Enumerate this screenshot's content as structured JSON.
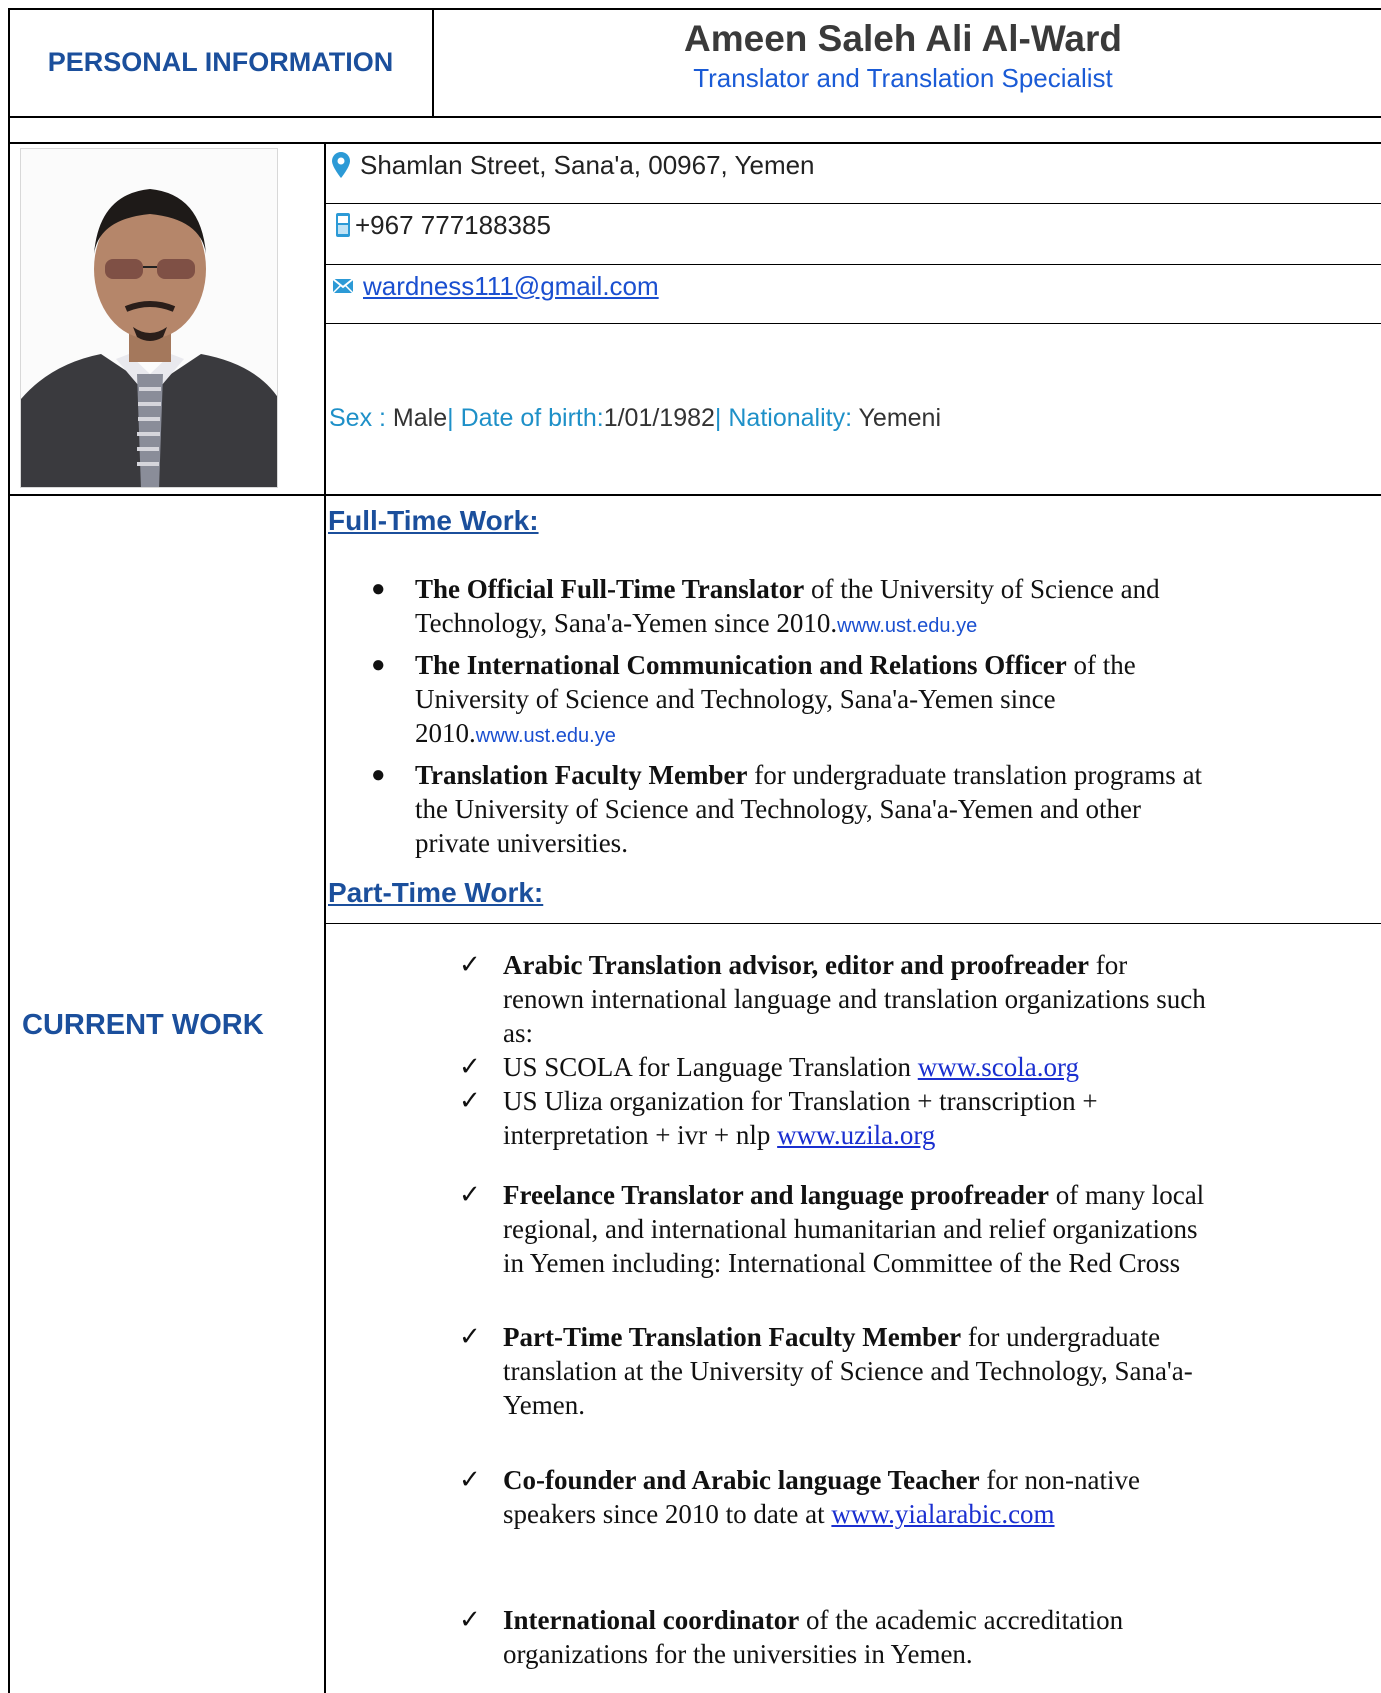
{
  "header": {
    "section_label": "PERSONAL INFORMATION",
    "name": "Ameen Saleh Ali Al-Ward",
    "title": "Translator and Translation Specialist"
  },
  "photo": {
    "description": "portrait-photo"
  },
  "contact": {
    "address": "Shamlan Street, Sana'a, 00967, Yemen",
    "phone": "+967 777188385",
    "email": "wardness111@gmail.com"
  },
  "personal": {
    "sex_label": "Sex : ",
    "sex_value": "Male",
    "sep1": "| ",
    "dob_label": "Date of birth:",
    "dob_value": "1/01/1982",
    "sep2": "| ",
    "nationality_label": "Nationality: ",
    "nationality_value": "Yemeni"
  },
  "current_work": {
    "section_label": "CURRENT WORK",
    "full_time_heading": "Full-Time Work:",
    "full_time_items": [
      {
        "bold": "The Official Full-Time Translator",
        "l1": " of the University of Science and",
        "l2": "Technology, Sana'a-Yemen since 2010.",
        "url": "www.ust.edu.ye"
      },
      {
        "bold": "The International Communication and Relations Officer",
        "l1": " of the",
        "l2": "University of Science and Technology, Sana'a-Yemen since",
        "l3": "2010.",
        "url": "www.ust.edu.ye"
      },
      {
        "bold": "Translation Faculty Member",
        "l1": " for undergraduate translation programs at",
        "l2": "the University of Science and Technology, Sana'a-Yemen and other",
        "l3": "private universities."
      }
    ],
    "part_time_heading": "Part-Time Work:",
    "part_time_items": [
      {
        "bold": "Arabic Translation advisor, editor and proofreader",
        "l1": " for",
        "l2": "renown international language and translation organizations such",
        "l3": "as:"
      },
      {
        "text": "US SCOLA for Language Translation ",
        "link": "www.scola.org"
      },
      {
        "l1": "US Uliza organization for Translation + transcription +",
        "l2": "interpretation + ivr + nlp ",
        "link": "www.uzila.org"
      },
      {
        "bold": "Freelance Translator and language proofreader",
        "l1": " of many local",
        "l2": "regional, and international humanitarian and relief organizations",
        "l3": "in Yemen including: International Committee of the Red Cross"
      },
      {
        "bold": "Part-Time Translation Faculty Member",
        "l1": " for undergraduate",
        "l2": "translation at the University of Science and Technology, Sana'a-",
        "l3": "Yemen."
      },
      {
        "bold": "Co-founder and Arabic language Teacher",
        "l1": " for non-native",
        "l2": "speakers since 2010 to date at ",
        "link": "www.yialarabic.com"
      },
      {
        "bold": "International coordinator",
        "l1": " of the academic accreditation",
        "l2": "organizations for the universities in Yemen."
      }
    ]
  }
}
